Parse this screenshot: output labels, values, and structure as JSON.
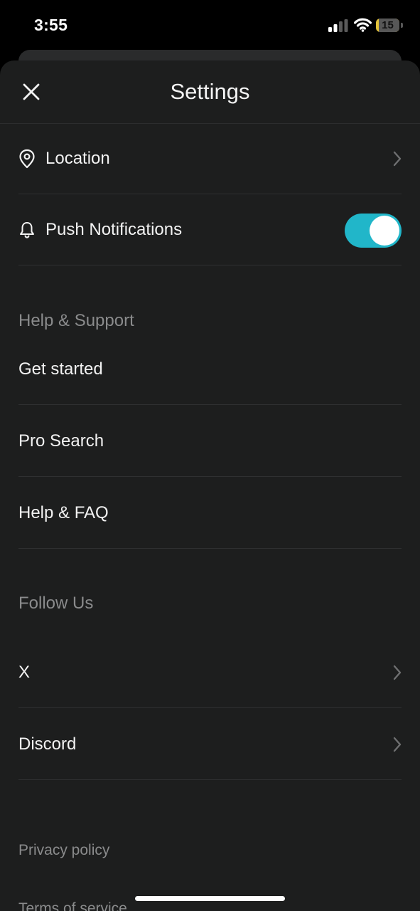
{
  "status_bar": {
    "time": "3:55",
    "battery": "15",
    "battery_color": "#e4c33a"
  },
  "header": {
    "title": "Settings",
    "close_icon": "close-icon"
  },
  "settings": {
    "location": {
      "label": "Location",
      "icon": "location-pin-icon"
    },
    "push_notifications": {
      "label": "Push Notifications",
      "icon": "bell-icon",
      "enabled": true,
      "toggle_color": "#21b6c9"
    }
  },
  "help_support": {
    "title": "Help & Support",
    "items": [
      {
        "label": "Get started"
      },
      {
        "label": "Pro Search"
      },
      {
        "label": "Help & FAQ"
      }
    ]
  },
  "follow_us": {
    "title": "Follow Us",
    "items": [
      {
        "label": "X"
      },
      {
        "label": "Discord"
      }
    ]
  },
  "footer": {
    "privacy": "Privacy policy",
    "terms": "Terms of service"
  }
}
